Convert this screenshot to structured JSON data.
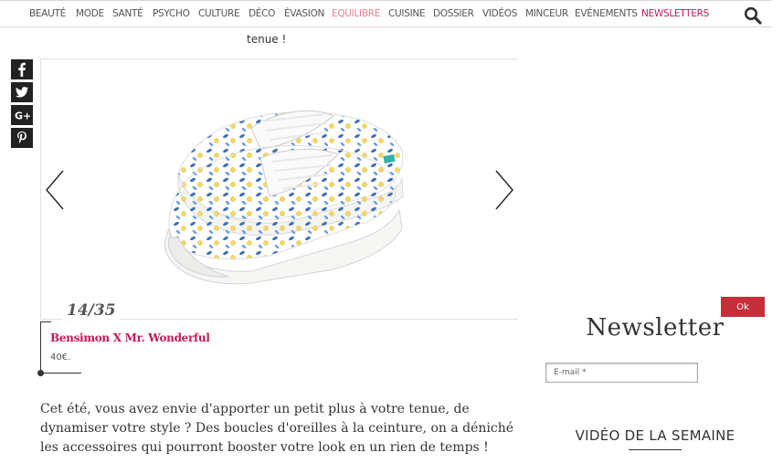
{
  "nav": {
    "items": [
      {
        "label": "BEAUTÉ"
      },
      {
        "label": "MODE"
      },
      {
        "label": "SANTÉ"
      },
      {
        "label": "PSYCHO"
      },
      {
        "label": "CULTURE"
      },
      {
        "label": "DÉCO"
      },
      {
        "label": "ÉVASION"
      },
      {
        "label": "EQUILIBRE"
      },
      {
        "label": "CUISINE"
      },
      {
        "label": "DOSSIER"
      },
      {
        "label": "VIDÉOS"
      },
      {
        "label": "MINCEUR"
      },
      {
        "label": "EVÉNEMENTS"
      },
      {
        "label": "NEWSLETTERS"
      }
    ],
    "search_icon": "search-icon",
    "active_color": "#e4838e",
    "highlight_color": "#c2185b"
  },
  "caption_top": "tenue !",
  "share": {
    "icons": [
      "facebook-icon",
      "twitter-icon",
      "google-plus-icon",
      "pinterest-icon"
    ]
  },
  "slider": {
    "image_alt": "sneaker-image",
    "counter": "14/35",
    "prev_icon": "chevron-left-icon",
    "next_icon": "chevron-right-icon"
  },
  "product": {
    "name": "Bensimon X Mr. Wonderful",
    "price": "40€."
  },
  "article": {
    "text": "Cet été, vous avez envie d'apporter un petit plus à votre tenue, de dynamiser votre style ? Des boucles d'oreilles à la ceinture, on a déniché les accessoires qui pourront booster votre look en un rien de temps !"
  },
  "newsletter": {
    "title": "Newsletter",
    "email_placeholder": "E-mail *",
    "ok_label": "Ok",
    "accent": "#c62f3a"
  },
  "video": {
    "title": "VIDÉO DE LA SEMAINE"
  }
}
